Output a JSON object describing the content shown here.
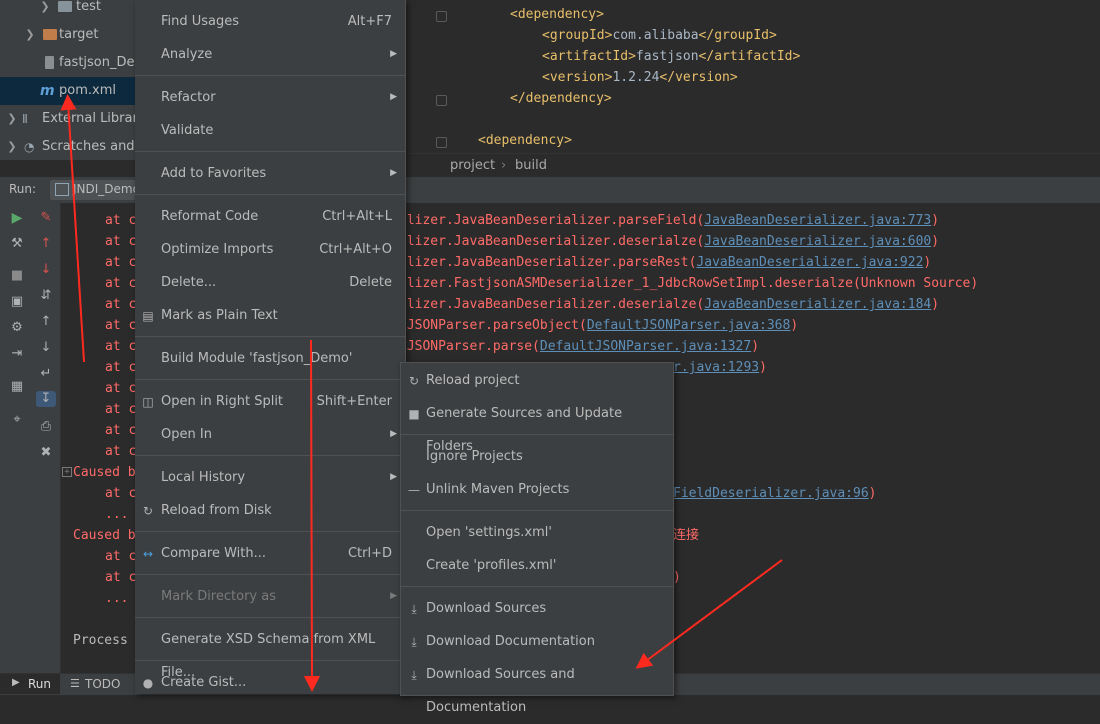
{
  "project_tree": {
    "items": [
      {
        "label": "test"
      },
      {
        "label": "target"
      },
      {
        "label": "fastjson_Demo"
      },
      {
        "label": "pom.xml",
        "icon": "m"
      },
      {
        "label": "External Libraries"
      },
      {
        "label": "Scratches and Consoles"
      }
    ]
  },
  "editor": {
    "lines": [
      {
        "open": "<dependency>",
        "value": "",
        "close": ""
      },
      {
        "open": "<groupId>",
        "value": "com.alibaba",
        "close": "</groupId>"
      },
      {
        "open": "<artifactId>",
        "value": "fastjson",
        "close": "</artifactId>"
      },
      {
        "open": "<version>",
        "value": "1.2.24",
        "close": "</version>"
      },
      {
        "open": "</dependency>",
        "value": "",
        "close": ""
      },
      {
        "open": "",
        "value": "",
        "close": ""
      },
      {
        "open": "<dependency>",
        "value": "",
        "close": ""
      }
    ],
    "breadcrumb": [
      "project",
      "build"
    ]
  },
  "run_panel": {
    "label": "Run:",
    "tab": "JNDI_Demo"
  },
  "console": {
    "left_fragments": [
      "at c",
      "at c",
      "at c",
      "at c",
      "at c",
      "at c",
      "at c",
      "at c",
      "at c",
      "at c",
      "at c",
      "at c",
      "Caused b",
      "at c",
      "...",
      "Caused b",
      "at c",
      "at c",
      "...",
      "",
      "Process"
    ],
    "right_lines": [
      {
        "method": "alizer.JavaBeanDeserializer.parseField(",
        "link": "JavaBeanDeserializer.java:773",
        "tail": ")"
      },
      {
        "method": "alizer.JavaBeanDeserializer.deserialze(",
        "link": "JavaBeanDeserializer.java:600",
        "tail": ")"
      },
      {
        "method": "alizer.JavaBeanDeserializer.parseRest(",
        "link": "JavaBeanDeserializer.java:922",
        "tail": ")"
      },
      {
        "method": "alizer.FastjsonASMDeserializer_1_JdbcRowSetImpl.deserialze(Unknown Source)",
        "link": "",
        "tail": ""
      },
      {
        "method": "alizer.JavaBeanDeserializer.deserialze(",
        "link": "JavaBeanDeserializer.java:184",
        "tail": ")"
      },
      {
        "method": "tJSONParser.parseObject(",
        "link": "DefaultJSONParser.java:368",
        "tail": ")"
      },
      {
        "method": "tJSONParser.parse(",
        "link": "DefaultJSONParser.java:1327",
        "tail": ")"
      },
      {
        "method": "",
        "link": "r.java:1293",
        "tail": ")"
      }
    ],
    "extra": {
      "field_link": "FieldDeserializer.java:96",
      "field_tail": ")",
      "cjk": "连接",
      "paren": ")"
    }
  },
  "context_menu": {
    "items": [
      {
        "label": "Find Usages",
        "shortcut": "Alt+F7"
      },
      {
        "label": "Analyze",
        "submenu": true
      },
      {
        "label": "Refactor",
        "submenu": true
      },
      {
        "label": "Validate"
      },
      {
        "label": "Add to Favorites",
        "submenu": true
      },
      {
        "label": "Reformat Code",
        "shortcut": "Ctrl+Alt+L"
      },
      {
        "label": "Optimize Imports",
        "shortcut": "Ctrl+Alt+O"
      },
      {
        "label": "Delete...",
        "shortcut": "Delete"
      },
      {
        "label": "Mark as Plain Text"
      },
      {
        "label": "Build Module 'fastjson_Demo'"
      },
      {
        "label": "Open in Right Split",
        "shortcut": "Shift+Enter"
      },
      {
        "label": "Open In",
        "submenu": true
      },
      {
        "label": "Local History",
        "submenu": true
      },
      {
        "label": "Reload from Disk"
      },
      {
        "label": "Compare With...",
        "shortcut": "Ctrl+D"
      },
      {
        "label": "Mark Directory as",
        "submenu": true,
        "disabled": true
      },
      {
        "label": "Generate XSD Schema from XML File..."
      },
      {
        "label": "Create Gist..."
      }
    ]
  },
  "maven_submenu": {
    "items": [
      {
        "label": "Reload project"
      },
      {
        "label": "Generate Sources and Update Folders"
      },
      {
        "label": "Ignore Projects"
      },
      {
        "label": "Unlink Maven Projects"
      },
      {
        "label": "Open 'settings.xml'"
      },
      {
        "label": "Create 'profiles.xml'"
      },
      {
        "label": "Download Sources"
      },
      {
        "label": "Download Documentation"
      },
      {
        "label": "Download Sources and Documentation"
      }
    ]
  },
  "bottom_bar": {
    "run": "Run",
    "todo": "TODO"
  },
  "colors": {
    "accent_red": "#ff2a1f",
    "xml_tag": "#e8bf6a",
    "error_text": "#ff6b68",
    "selection": "#0d293e"
  }
}
